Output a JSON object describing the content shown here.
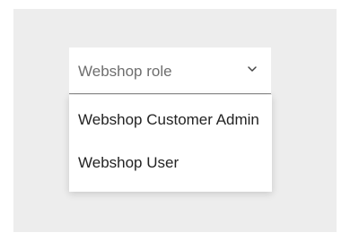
{
  "select": {
    "placeholder": "Webshop role",
    "icon": "chevron-down-icon"
  },
  "menu": {
    "items": [
      {
        "label": "Webshop Customer Admin"
      },
      {
        "label": "Webshop User"
      }
    ]
  },
  "colors": {
    "background": "#ededed",
    "surface": "#ffffff",
    "text_primary": "#232323",
    "text_secondary": "#6e6e6e",
    "underline": "#8f8f8f"
  }
}
